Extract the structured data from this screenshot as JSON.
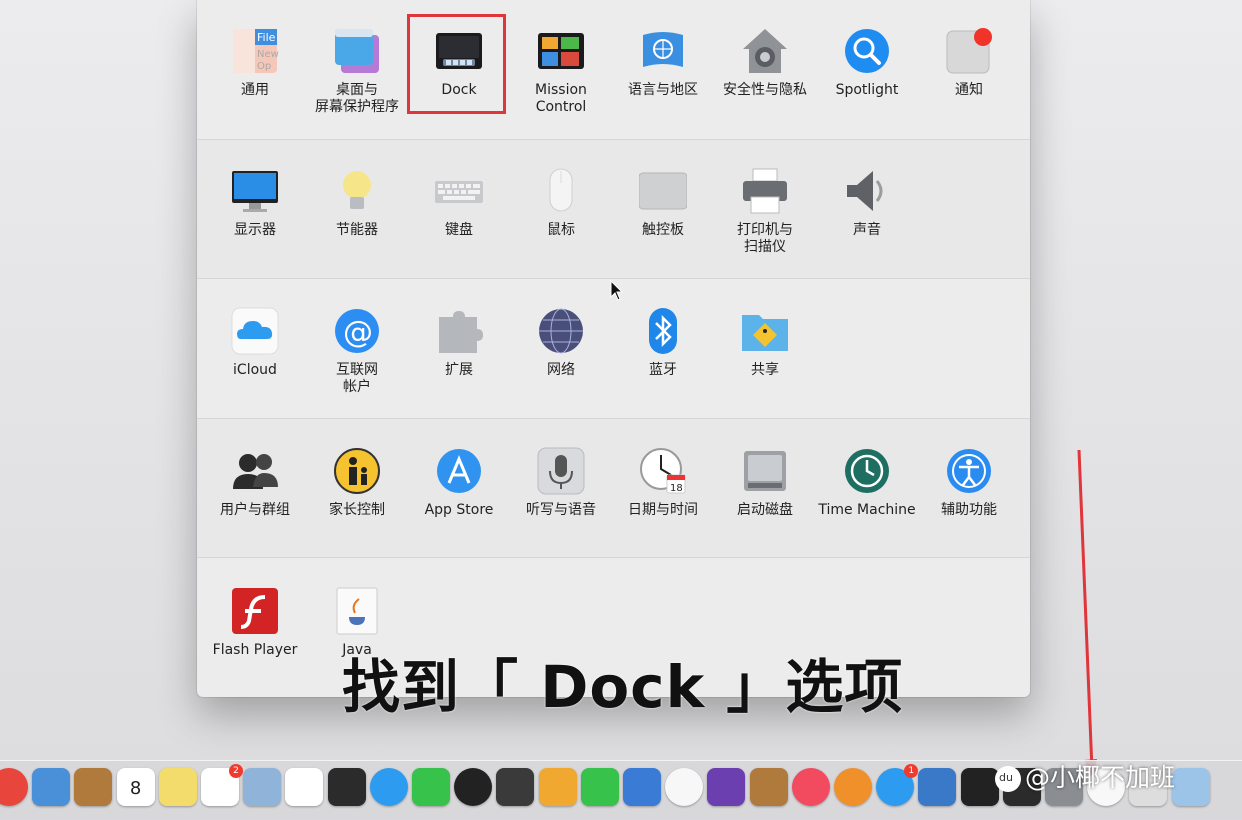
{
  "window": {
    "rows": [
      [
        {
          "id": "general",
          "label": "通用",
          "icon": "general-icon"
        },
        {
          "id": "desktop-screensaver",
          "label": "桌面与\n屏幕保护程序",
          "icon": "desktop-icon"
        },
        {
          "id": "dock",
          "label": "Dock",
          "icon": "dock-icon"
        },
        {
          "id": "mission-control",
          "label": "Mission\nControl",
          "icon": "mission-control-icon"
        },
        {
          "id": "language-region",
          "label": "语言与地区",
          "icon": "un-flag-icon"
        },
        {
          "id": "security-privacy",
          "label": "安全性与隐私",
          "icon": "house-lock-icon"
        },
        {
          "id": "spotlight",
          "label": "Spotlight",
          "icon": "magnifier-icon"
        },
        {
          "id": "notifications",
          "label": "通知",
          "icon": "notification-icon"
        }
      ],
      [
        {
          "id": "displays",
          "label": "显示器",
          "icon": "monitor-icon"
        },
        {
          "id": "energy-saver",
          "label": "节能器",
          "icon": "lightbulb-icon"
        },
        {
          "id": "keyboard",
          "label": "键盘",
          "icon": "keyboard-icon"
        },
        {
          "id": "mouse",
          "label": "鼠标",
          "icon": "mouse-icon"
        },
        {
          "id": "trackpad",
          "label": "触控板",
          "icon": "trackpad-icon"
        },
        {
          "id": "printers-scanners",
          "label": "打印机与\n扫描仪",
          "icon": "printer-icon"
        },
        {
          "id": "sound",
          "label": "声音",
          "icon": "speaker-icon"
        }
      ],
      [
        {
          "id": "icloud",
          "label": "iCloud",
          "icon": "cloud-icon"
        },
        {
          "id": "internet-accounts",
          "label": "互联网\n帐户",
          "icon": "at-sign-icon"
        },
        {
          "id": "extensions",
          "label": "扩展",
          "icon": "puzzle-icon"
        },
        {
          "id": "network",
          "label": "网络",
          "icon": "globe-icon"
        },
        {
          "id": "bluetooth",
          "label": "蓝牙",
          "icon": "bluetooth-icon"
        },
        {
          "id": "sharing",
          "label": "共享",
          "icon": "sharing-folder-icon"
        }
      ],
      [
        {
          "id": "users-groups",
          "label": "用户与群组",
          "icon": "users-icon"
        },
        {
          "id": "parental-controls",
          "label": "家长控制",
          "icon": "parental-icon"
        },
        {
          "id": "app-store",
          "label": "App Store",
          "icon": "app-store-icon"
        },
        {
          "id": "dictation-speech",
          "label": "听写与语音",
          "icon": "microphone-icon"
        },
        {
          "id": "date-time",
          "label": "日期与时间",
          "icon": "clock-icon"
        },
        {
          "id": "startup-disk",
          "label": "启动磁盘",
          "icon": "disk-icon"
        },
        {
          "id": "time-machine",
          "label": "Time Machine",
          "icon": "time-machine-icon"
        },
        {
          "id": "accessibility",
          "label": "辅助功能",
          "icon": "accessibility-icon"
        }
      ],
      [
        {
          "id": "flash-player",
          "label": "Flash Player",
          "icon": "flash-icon"
        },
        {
          "id": "java",
          "label": "Java",
          "icon": "java-icon"
        }
      ]
    ]
  },
  "caption": "找到「 Dock 」选项",
  "watermark": "@小椰不加班",
  "watermark_logo": "du",
  "dock_badges": {
    "reminders": "2",
    "app_store": "1"
  },
  "dock_apps": [
    "chrome-icon",
    "preview-icon",
    "contacts-icon",
    "calendar-icon",
    "notes-icon",
    "reminders-icon",
    "photo-booth-icon",
    "writer-icon",
    "writer-dark-icon",
    "messages-icon",
    "facetime-icon",
    "camera-icon",
    "imovie-icon",
    "pages-icon",
    "numbers-icon",
    "keynote-icon",
    "photos-icon",
    "imovie-star-icon",
    "garageband-icon",
    "itunes-icon",
    "ibooks-icon",
    "app-store-icon",
    "xcode-icon",
    "terminal-icon",
    "terminal-dark-icon",
    "system-preferences-icon",
    "qq-icon",
    "finder-doc-icon",
    "preview-image-icon"
  ],
  "calendar_day": "8",
  "date_badge": "18",
  "colors": {
    "highlight": "#e0353b",
    "accent_blue": "#1a8cf0",
    "arrow": "#e0353b"
  }
}
